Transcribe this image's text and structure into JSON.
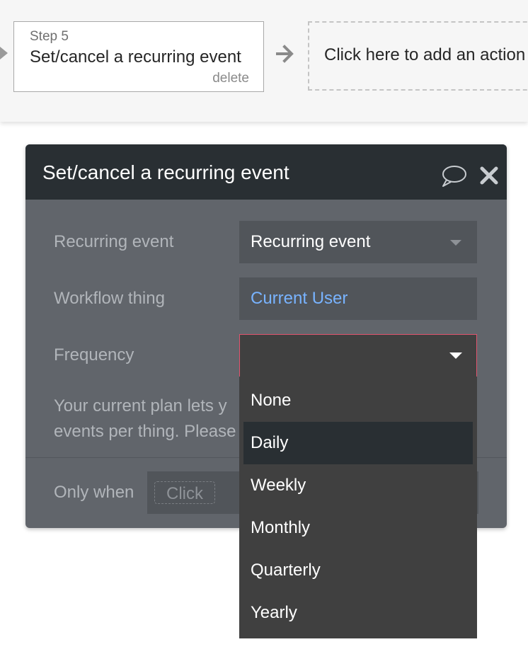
{
  "step": {
    "number_label": "Step 5",
    "title": "Set/cancel a recurring event",
    "delete_label": "delete"
  },
  "add_action": {
    "label": "Click here to add an action"
  },
  "panel": {
    "title": "Set/cancel a recurring event",
    "fields": {
      "recurring_event": {
        "label": "Recurring event",
        "value": "Recurring event"
      },
      "workflow_thing": {
        "label": "Workflow thing",
        "value": "Current User"
      },
      "frequency": {
        "label": "Frequency",
        "value": ""
      }
    },
    "info_line1": "Your current plan lets y",
    "info_line2": "events per thing. Please",
    "only_when": {
      "label": "Only when",
      "placeholder": "Click"
    }
  },
  "dropdown": {
    "options": [
      "None",
      "Daily",
      "Weekly",
      "Monthly",
      "Quarterly",
      "Yearly"
    ],
    "highlighted": "Daily"
  },
  "colors": {
    "panel_bg": "#61656b",
    "header_bg": "#292f33",
    "link": "#78b3ff",
    "focus_border": "#e0546e"
  },
  "icons": {
    "step_arrow": "arrow-right-icon",
    "comment": "speech-bubble-icon",
    "close": "close-icon"
  }
}
